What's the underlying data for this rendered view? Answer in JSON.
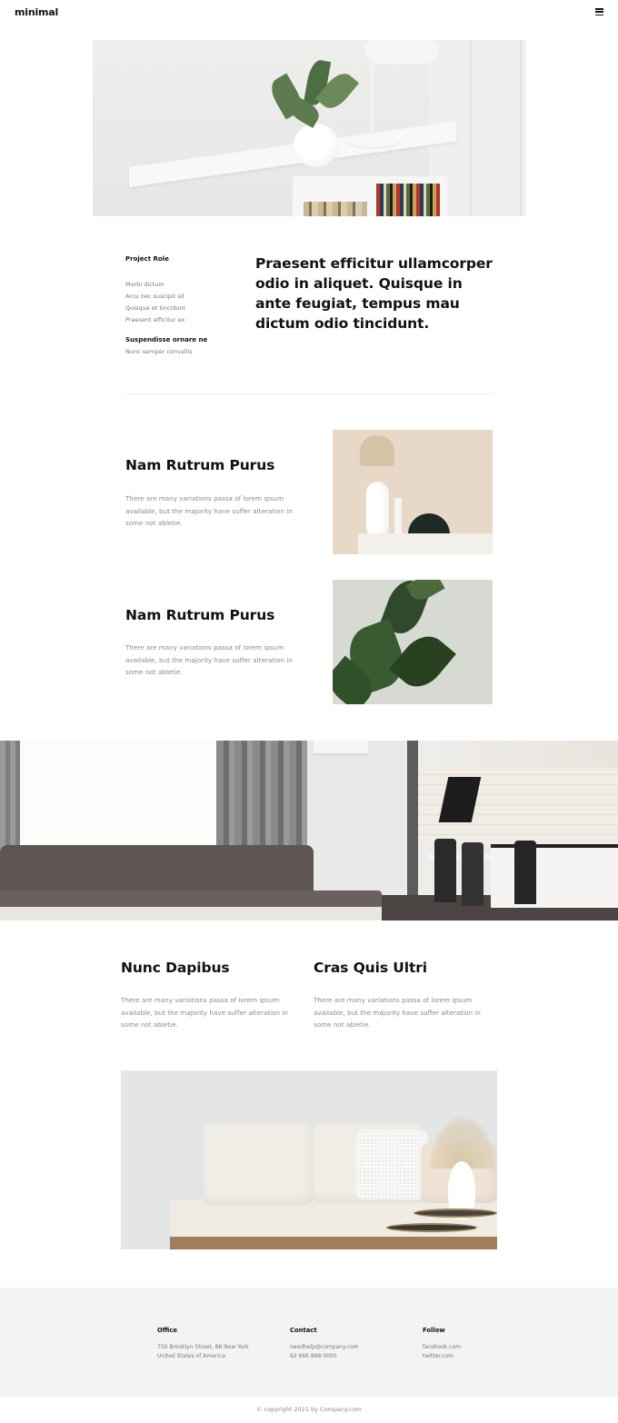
{
  "header": {
    "logo": "minimal",
    "menu_icon": "hamburger-menu-icon"
  },
  "project": {
    "role_label": "Project Role",
    "role_items": [
      "Morbi dictum",
      "Arcu nec suscipit sit",
      "Quisque et tincidunt",
      "Praesent efficitur ex"
    ],
    "sub_label": "Suspendisse ornare ne",
    "sub_item": "Nunc semper convallis",
    "lead": "Praesent efficitur ullamcorper odio in aliquet. Quisque in ante feugiat, tempus mau dictum odio tincidunt."
  },
  "features": [
    {
      "title": "Nam Rutrum Purus",
      "text": "There are many variations passa of lorem ipsum available, but the majority have suffer alteration in some not abletie."
    },
    {
      "title": "Nam Rutrum Purus",
      "text": "There are many variations passa of lorem ipsum available, but the majority have suffer alteration in some not abletie."
    }
  ],
  "columns": [
    {
      "title": "Nunc Dapibus",
      "text": "There are many variations passa of lorem ipsum available, but the majority have suffer alteration in some not abletie."
    },
    {
      "title": "Cras Quis Ultri",
      "text": "There are many variations passa of lorem ipsum available, but the majority have suffer alteration in some not abletie."
    }
  ],
  "footer": {
    "office": {
      "heading": "Office",
      "line1": "750 Brooklyn Street, 88 New York",
      "line2": "United States of America"
    },
    "contact": {
      "heading": "Contact",
      "line1": "needhelp@company.com",
      "line2": "92 666 888 0000"
    },
    "follow": {
      "heading": "Follow",
      "line1": "facebook.com",
      "line2": "twitter.com"
    },
    "copyright": "© copyright 2021 by Company.com"
  },
  "colors": {
    "text": "#111111",
    "muted": "#8a8a8a",
    "footer_bg": "#f3f3f3"
  }
}
